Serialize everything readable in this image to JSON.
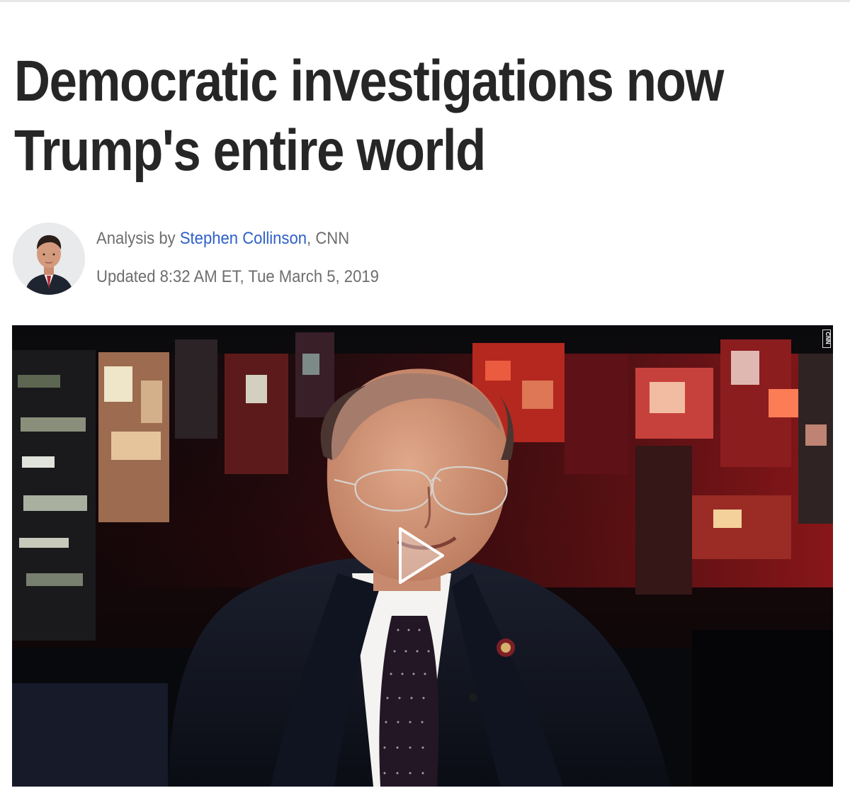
{
  "article": {
    "headline_line_1": "Democratic investigations now",
    "headline_line_2": "Trump's entire world",
    "byline": {
      "prefix": "Analysis by ",
      "author": "Stephen Collinson",
      "suffix": ", CNN"
    },
    "updated": "Updated 8:32 AM ET, Tue March 5, 2019"
  },
  "video": {
    "watermark": "CNN",
    "play_icon": "play-icon"
  },
  "colors": {
    "headline": "#262626",
    "meta_text": "#6e6e6e",
    "author_link": "#2f60c9",
    "video_background": "#050506"
  }
}
